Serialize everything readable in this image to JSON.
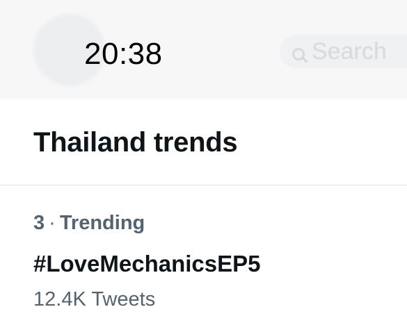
{
  "status_bar": {
    "time": "20:38"
  },
  "header": {
    "search_placeholder": "Search",
    "icons": [
      "avatar",
      "search-icon"
    ]
  },
  "section": {
    "title": "Thailand trends"
  },
  "trends": [
    {
      "rank": "3",
      "separator": "·",
      "category": "Trending",
      "name": "#LoveMechanicsEP5",
      "count": "12.4K Tweets"
    }
  ],
  "colors": {
    "primary_text": "#0f1419",
    "secondary_text": "#536471",
    "divider": "#e1e5e8",
    "top_bar_background": "#f7f7f8"
  }
}
